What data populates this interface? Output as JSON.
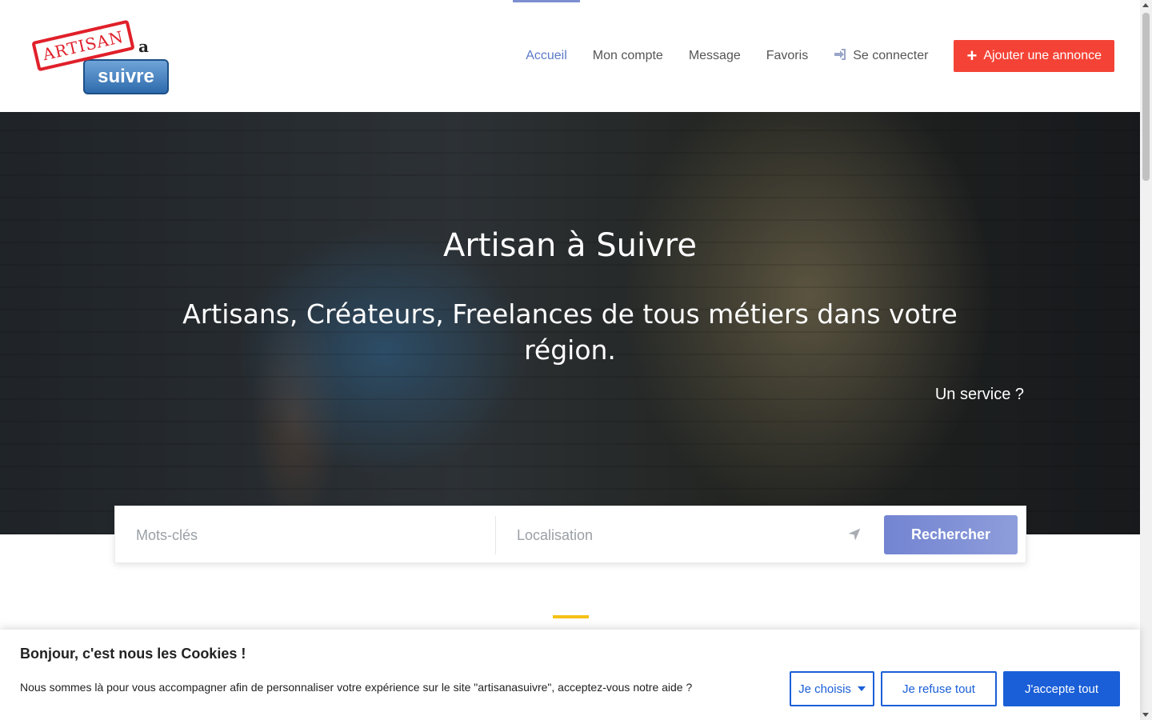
{
  "logo": {
    "stamp_text": "ARTISAN",
    "a_text": "a",
    "suivre_text": "suivre"
  },
  "nav": {
    "items": [
      {
        "label": "Accueil",
        "active": true
      },
      {
        "label": "Mon compte"
      },
      {
        "label": "Message"
      },
      {
        "label": "Favoris"
      },
      {
        "label": "Se connecter",
        "icon": "login-icon"
      }
    ],
    "add_button": {
      "label": "Ajouter une annonce",
      "icon": "plus-icon",
      "color": "#f44336"
    }
  },
  "hero": {
    "title": "Artisan à Suivre",
    "subtitle": "Artisans, Créateurs, Freelances de tous métiers dans votre région.",
    "service_link": "Un service ?"
  },
  "search": {
    "keywords_placeholder": "Mots-clés",
    "location_placeholder": "Localisation",
    "location_icon": "location-arrow-icon",
    "button_label": "Rechercher",
    "button_color": "#7384d2"
  },
  "cookie_banner": {
    "title": "Bonjour, c'est nous les Cookies !",
    "text": "Nous sommes là pour vous accompagner afin de personnaliser votre expérience sur le site \"artisanasuivre\", acceptez-vous notre aide ?",
    "choose_label": "Je choisis",
    "refuse_label": "Je refuse tout",
    "accept_label": "J'accepte tout",
    "accent_color": "#1a5fd8"
  }
}
